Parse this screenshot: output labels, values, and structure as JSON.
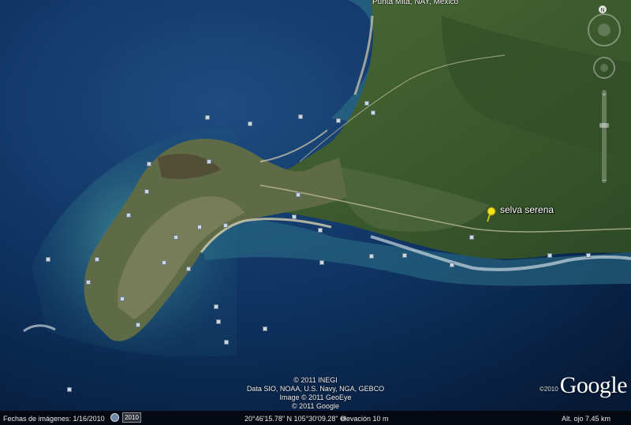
{
  "map": {
    "top_label": "Punta Mita, NAY, Mexico",
    "place_label": "selva serena",
    "pin_icon": "yellow-pushpin-icon",
    "nav_icons": [
      "north-arrow-icon",
      "look-joystick-icon",
      "move-joystick-icon",
      "zoom-slider-icon"
    ]
  },
  "credits": {
    "line1": "© 2011 INEGI",
    "line2": "Data SIO, NOAA, U.S. Navy, NGA, GEBCO",
    "line3": "Image © 2011 GeoEye",
    "line4": "© 2011 Google"
  },
  "logo": {
    "year": "©2010",
    "text": "Google"
  },
  "status": {
    "imagery_label": "Fechas de imágenes: 1/16/2010",
    "history_icon": "clock-history-icon",
    "year": "2010",
    "coords": "20°46'15.78\" N 105°30'09.28\" O",
    "elevation": "elevación    10 m",
    "eye_alt": "Alt. ojo    7.45 km"
  },
  "colors": {
    "ocean": "#0b2a52",
    "land": "#3e5b2f",
    "status_bg": "#050a12"
  }
}
